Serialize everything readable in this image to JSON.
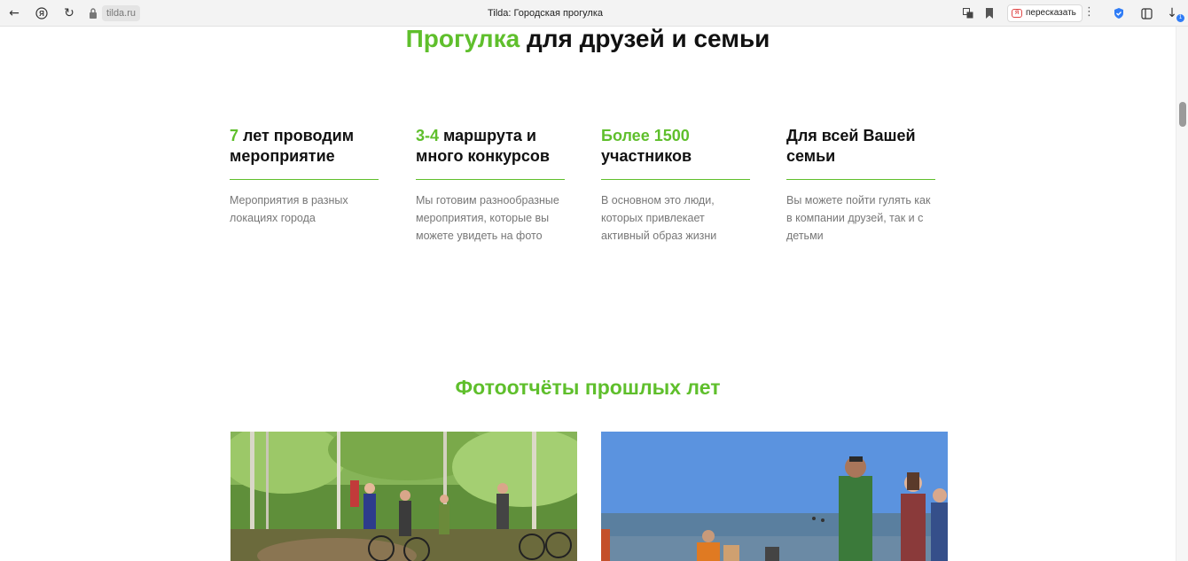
{
  "browser": {
    "host": "tilda.ru",
    "tab_title": "Tilda: Городская прогулка",
    "retell_label": "пересказать",
    "downloads_badge": "1"
  },
  "hero": {
    "title_accent": "Прогулка",
    "title_rest": " для друзей и семьи"
  },
  "features": [
    {
      "accent": "7",
      "rest": " лет проводим мероприятие",
      "text": "Мероприятия в разных локациях города"
    },
    {
      "accent": "3-4",
      "rest": " маршрута и много конкурсов",
      "text": "Мы готовим разнообразные мероприятия, которые вы можете увидеть на фото"
    },
    {
      "accent": "Более 1500",
      "rest": " участников",
      "text": "В основном это люди, которых привлекает активный образ жизни"
    },
    {
      "accent": "",
      "rest": "Для всей Вашей семьи",
      "text": "Вы можете пойти гулять как в компании друзей, так и с детьми"
    }
  ],
  "gallery": {
    "title": "Фотоотчёты прошлых лет"
  },
  "colors": {
    "accent": "#5fbf2c",
    "muted_text": "#777777"
  }
}
